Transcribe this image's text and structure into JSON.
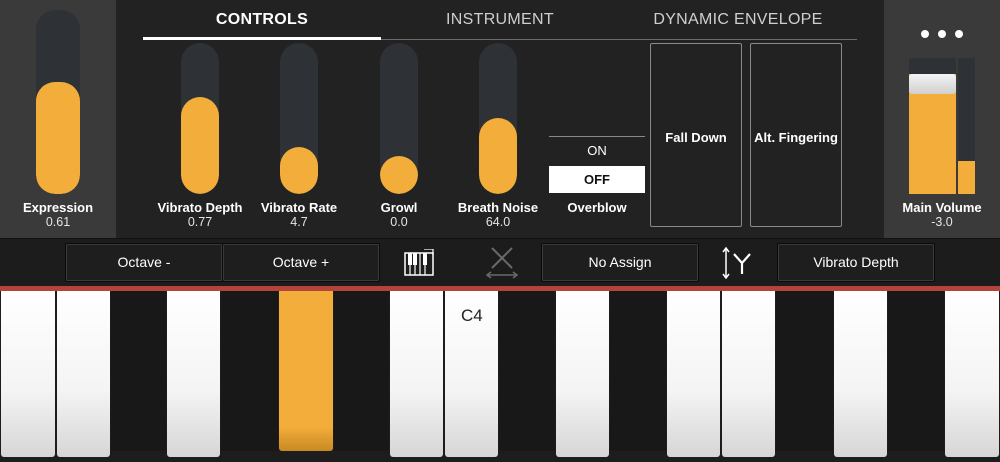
{
  "tabs": [
    {
      "label": "CONTROLS",
      "active": true
    },
    {
      "label": "INSTRUMENT",
      "active": false
    },
    {
      "label": "DYNAMIC ENVELOPE",
      "active": false
    }
  ],
  "expression": {
    "label": "Expression",
    "value": "0.61",
    "level": 0.61
  },
  "sliders": [
    {
      "label": "Vibrato Depth",
      "value": "0.77",
      "level": 0.64
    },
    {
      "label": "Vibrato Rate",
      "value": "4.7",
      "level": 0.31
    },
    {
      "label": "Growl",
      "value": "0.0",
      "level": 0.0
    },
    {
      "label": "Breath Noise",
      "value": "64.0",
      "level": 0.5
    }
  ],
  "overblow": {
    "label": "Overblow",
    "on_label": "ON",
    "off_label": "OFF",
    "selected": "OFF"
  },
  "pads": {
    "fall_down": "Fall Down",
    "alt_fingering": "Alt. Fingering"
  },
  "main_volume": {
    "label": "Main Volume",
    "value": "-3.0",
    "level": 0.88,
    "meter_level": 0.24
  },
  "toolbar": {
    "octave_minus": "Octave -",
    "octave_plus": "Octave +",
    "x_assign": "No Assign",
    "y_assign": "Vibrato Depth",
    "keyboard_icon": "keyboard-icon",
    "x_axis_icon": "x-axis-disabled-icon",
    "y_axis_icon": "y-axis-icon"
  },
  "keyboard": {
    "label": "C4"
  },
  "colors": {
    "accent": "#f2ad3a",
    "track": "#2e3236",
    "red_line": "#b4433b",
    "panel": "#3a3a3a"
  }
}
